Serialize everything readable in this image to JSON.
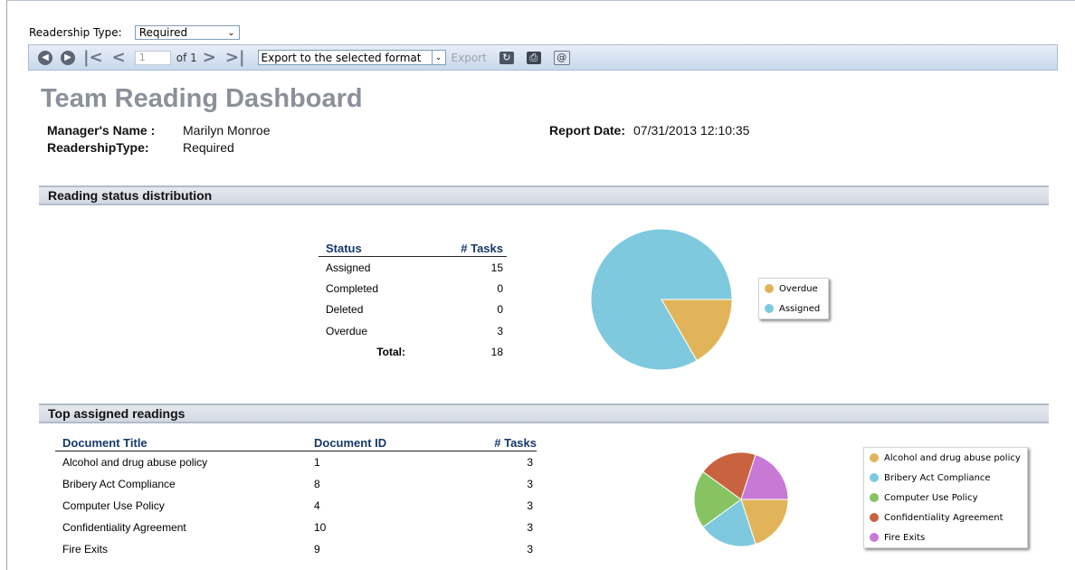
{
  "params": {
    "readership_label": "Readership Type:",
    "readership_value": "Required"
  },
  "toolbar": {
    "page_value": "1",
    "of_label": "of 1",
    "format_value": "Export to the selected format",
    "export_label": "Export"
  },
  "report": {
    "title": "Team Reading Dashboard",
    "manager_label": "Manager's Name :",
    "manager_value": "Marilyn Monroe",
    "readership_label": "ReadershipType:",
    "readership_value": "Required",
    "date_label": "Report Date:",
    "date_value": "07/31/2013 12:10:35"
  },
  "status_section": {
    "header": "Reading status distribution",
    "columns": [
      "Status",
      "# Tasks"
    ],
    "rows": [
      [
        "Assigned",
        "15"
      ],
      [
        "Completed",
        "0"
      ],
      [
        "Deleted",
        "0"
      ],
      [
        "Overdue",
        "3"
      ]
    ],
    "total_label": "Total:",
    "total_value": "18",
    "pie": [
      {
        "name": "Overdue",
        "value": 3,
        "color": "#e2b45a"
      },
      {
        "name": "Assigned",
        "value": 15,
        "color": "#7ec9dd"
      }
    ]
  },
  "readings_section": {
    "header": "Top assigned readings",
    "columns": [
      "Document Title",
      "Document ID",
      "# Tasks"
    ],
    "rows": [
      [
        "Alcohol and drug abuse policy",
        "1",
        "3"
      ],
      [
        "Bribery Act Compliance",
        "8",
        "3"
      ],
      [
        "Computer Use Policy",
        "4",
        "3"
      ],
      [
        "Confidentiality Agreement",
        "10",
        "3"
      ],
      [
        "Fire Exits",
        "9",
        "3"
      ]
    ],
    "pie": [
      {
        "name": "Alcohol and drug abuse policy",
        "value": 3,
        "color": "#e2b45a"
      },
      {
        "name": "Bribery Act Compliance",
        "value": 3,
        "color": "#7ec9dd"
      },
      {
        "name": "Computer Use Policy",
        "value": 3,
        "color": "#86c462"
      },
      {
        "name": "Confidentiality Agreement",
        "value": 3,
        "color": "#c9623f"
      },
      {
        "name": "Fire Exits",
        "value": 3,
        "color": "#c879d6"
      }
    ]
  }
}
